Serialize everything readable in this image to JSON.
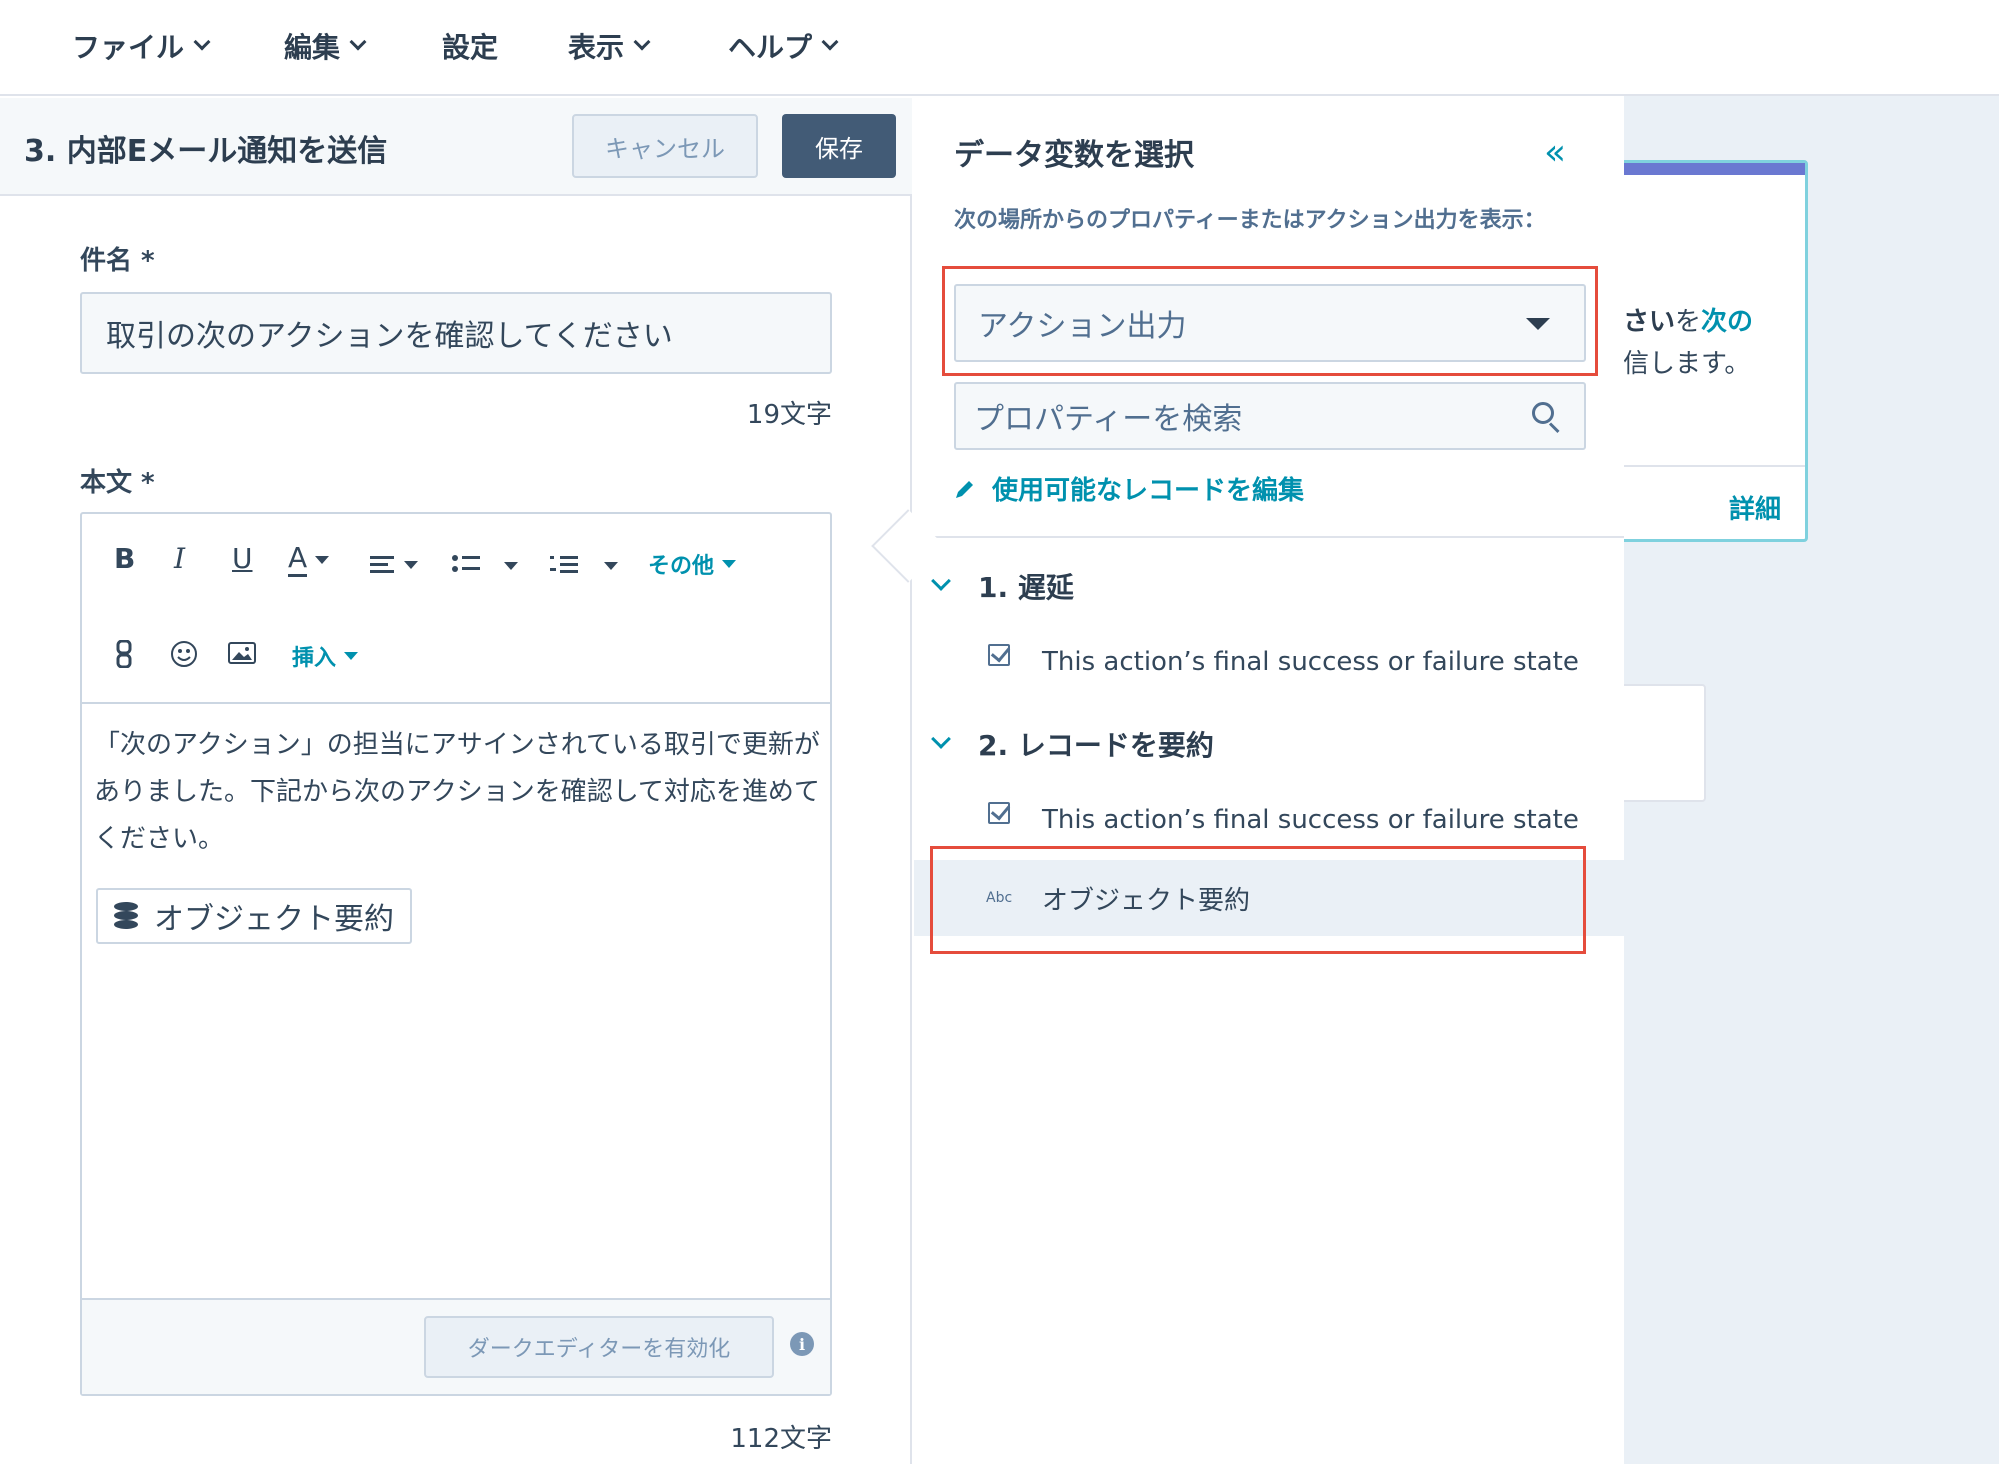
{
  "menubar": {
    "items": [
      {
        "label": "ファイル",
        "has_dropdown": true
      },
      {
        "label": "編集",
        "has_dropdown": true
      },
      {
        "label": "設定",
        "has_dropdown": false
      },
      {
        "label": "表示",
        "has_dropdown": true
      },
      {
        "label": "ヘルプ",
        "has_dropdown": true
      }
    ]
  },
  "editor_panel": {
    "title": "3. 内部Eメール通知を送信",
    "cancel_label": "キャンセル",
    "save_label": "保存",
    "subject_label": "件名 *",
    "subject_value": "取引の次のアクションを確認してください",
    "subject_count": "19文字",
    "body_label": "本文 *",
    "toolbar": {
      "bold": "B",
      "italic": "I",
      "underline": "U",
      "font_color": "A",
      "more_label": "その他",
      "insert_label": "挿入"
    },
    "body_text": "「次のアクション」の担当にアサインされている取引で更新がありました。下記から次のアクションを確認して対応を進めてください。",
    "token_label": "オブジェクト要約",
    "dark_editor_label": "ダークエディターを有効化",
    "info_icon": "i",
    "body_count": "112文字"
  },
  "data_panel": {
    "title": "データ変数を選択",
    "collapse_icon": "«",
    "source_label": "次の場所からのプロパティーまたはアクション出力を表示：",
    "source_selected": "アクション出力",
    "search_placeholder": "プロパティーを検索",
    "edit_records_label": "使用可能なレコードを編集",
    "groups": [
      {
        "title": "1. 遅延",
        "items": [
          {
            "icon": "checkbox-icon",
            "label": "This action’s final success or failure state"
          }
        ]
      },
      {
        "title": "2. レコードを要約",
        "items": [
          {
            "icon": "checkbox-icon",
            "label": "This action’s final success or failure state"
          },
          {
            "icon": "text-abc-icon",
            "icon_text": "Abc",
            "label": "オブジェクト要約",
            "selected": true
          }
        ]
      }
    ]
  },
  "background_card": {
    "text_bold": "さい",
    "text_normal": "を",
    "text_link": "次の",
    "line2": "信します。",
    "detail_label": "詳細"
  },
  "colors": {
    "accent": "#0091ae",
    "primary_button": "#425b76",
    "highlight": "#e54c3c",
    "text": "#33475b",
    "canvas": "#eaf0f6"
  }
}
